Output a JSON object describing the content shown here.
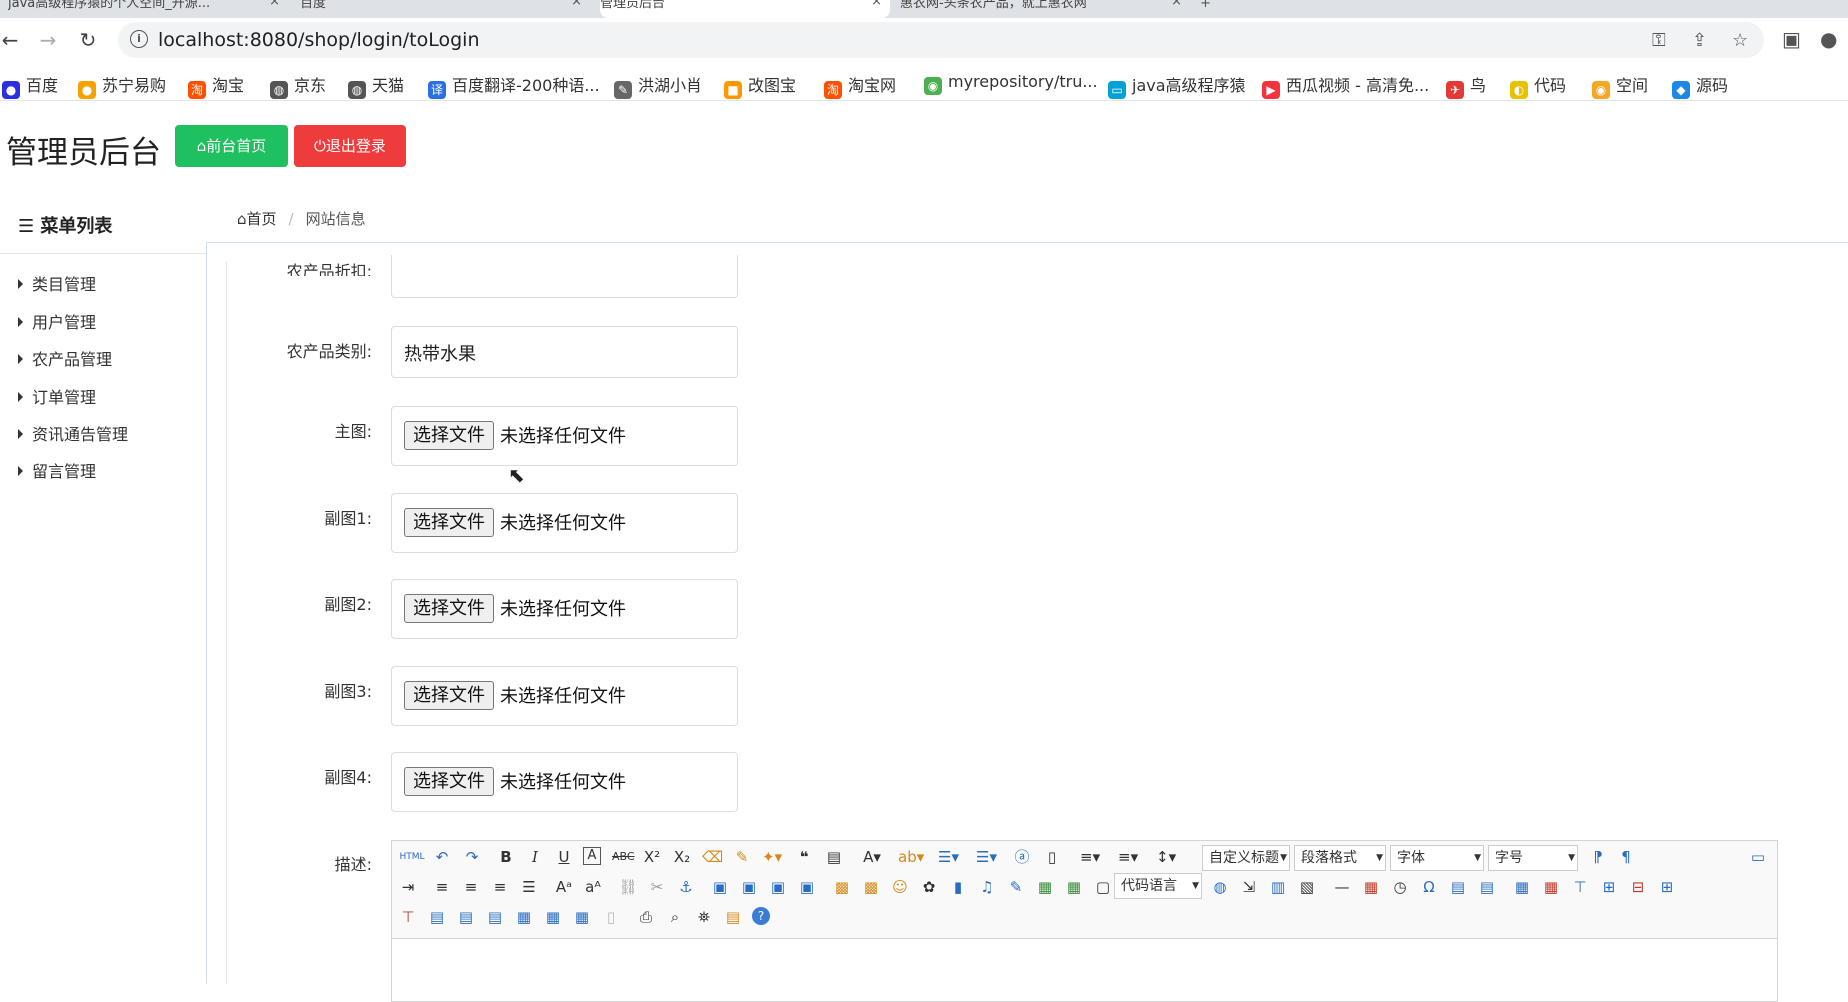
{
  "browser": {
    "tabs": [
      {
        "title": "java高级程序猿的个人空间_开源..."
      },
      {
        "title": "百度"
      },
      {
        "title": "管理员后台"
      },
      {
        "title": "惠农网-头条农产品，就上惠农网"
      }
    ],
    "url": "localhost:8080/shop/login/toLogin",
    "bookmarks": [
      {
        "label": "百度",
        "color": "#2932e1"
      },
      {
        "label": "苏宁易购",
        "color": "#f5a100"
      },
      {
        "label": "淘宝",
        "color": "#ff5000"
      },
      {
        "label": "京东",
        "color": "#555555"
      },
      {
        "label": "天猫",
        "color": "#555555"
      },
      {
        "label": "百度翻译-200种语...",
        "color": "#2b6fe1"
      },
      {
        "label": "洪湖小肖",
        "color": "#666666"
      },
      {
        "label": "改图宝",
        "color": "#ff9800"
      },
      {
        "label": "淘宝网",
        "color": "#ff5000"
      },
      {
        "label": "myrepository/tru...",
        "color": "#4caf50"
      },
      {
        "label": "java高级程序猿",
        "color": "#00a1d6"
      },
      {
        "label": "西瓜视频 - 高清免...",
        "color": "#f4333c"
      },
      {
        "label": "鸟",
        "color": "#e53935"
      },
      {
        "label": "代码",
        "color": "#e8c200"
      },
      {
        "label": "空间",
        "color": "#f5a623"
      },
      {
        "label": "源码",
        "color": "#1e88e5"
      }
    ]
  },
  "app": {
    "title": "管理员后台",
    "home_button": "前台首页",
    "logout_button": "退出登录",
    "accent_green": "#1fc05f",
    "accent_red": "#ee3b3b"
  },
  "sidebar": {
    "title": "菜单列表",
    "items": [
      {
        "label": "类目管理"
      },
      {
        "label": "用户管理"
      },
      {
        "label": "农产品管理"
      },
      {
        "label": "订单管理"
      },
      {
        "label": "资讯通告管理"
      },
      {
        "label": "留言管理"
      }
    ]
  },
  "breadcrumb": {
    "home": "首页",
    "current": "网站信息"
  },
  "form": {
    "discount_label": "农产品折扣:",
    "category_label": "农产品类别:",
    "category_value": "热带水果",
    "file_button": "选择文件",
    "file_empty": "未选择任何文件",
    "file_fields": [
      {
        "label": "主图:"
      },
      {
        "label": "副图1:"
      },
      {
        "label": "副图2:"
      },
      {
        "label": "副图3:"
      },
      {
        "label": "副图4:"
      }
    ],
    "desc_label": "描述:"
  },
  "editor": {
    "html_label": "HTML",
    "custom_heading": "自定义标题",
    "paragraph": "段落格式",
    "font": "字体",
    "size": "字号",
    "code_lang": "代码语言"
  }
}
